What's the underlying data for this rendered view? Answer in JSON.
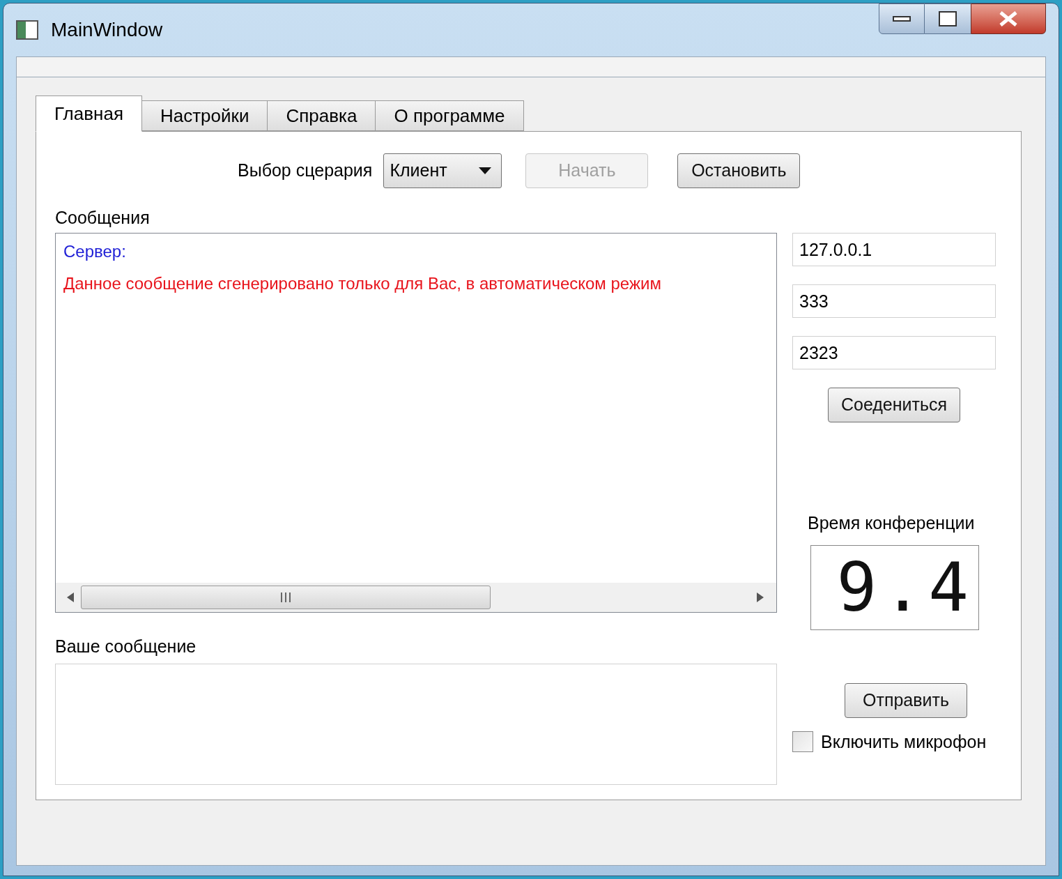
{
  "window": {
    "title": "MainWindow"
  },
  "tabs": [
    {
      "label": "Главная",
      "selected": true
    },
    {
      "label": "Настройки",
      "selected": false
    },
    {
      "label": "Справка",
      "selected": false
    },
    {
      "label": "О программе",
      "selected": false
    }
  ],
  "scenario": {
    "label": "Выбор сцерария",
    "value": "Клиент"
  },
  "buttons": {
    "start": {
      "label": "Начать",
      "disabled": true
    },
    "stop": {
      "label": "Остановить",
      "disabled": false
    },
    "connect": {
      "label": "Соедениться",
      "disabled": false
    },
    "send": {
      "label": "Отправить",
      "disabled": false
    }
  },
  "messages": {
    "label": "Сообщения",
    "lines": [
      {
        "text": "Сервер:",
        "color": "#1f1fd6"
      },
      {
        "text": "Данное сообщение сгенерировано только для Вас, в автоматическом режим",
        "color": "#e8141c"
      }
    ]
  },
  "your_message": {
    "label": "Ваше сообщение"
  },
  "fields": [
    {
      "value": "127.0.0.1"
    },
    {
      "value": "333"
    },
    {
      "value": "2323"
    }
  ],
  "conference_time": {
    "label": "Время конференции",
    "reading": "9.4"
  },
  "microphone": {
    "label": "Включить микрофон",
    "checked": false
  }
}
